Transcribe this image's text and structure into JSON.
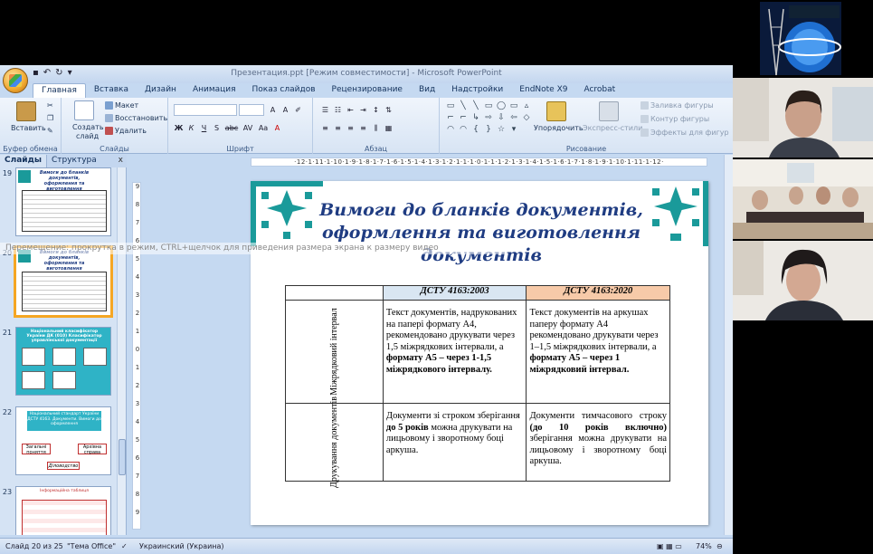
{
  "window": {
    "title": "Презентация.ppt [Режим совместимости] - Microsoft PowerPoint"
  },
  "ribbon": {
    "tabs": [
      "Главная",
      "Вставка",
      "Дизайн",
      "Анимация",
      "Показ слайдов",
      "Рецензирование",
      "Вид",
      "Надстройки",
      "EndNote X9",
      "Acrobat"
    ],
    "active_tab": "Главная",
    "clipboard": {
      "paste": "Вставить",
      "label": "Буфер обмена"
    },
    "slides_group": {
      "create": "Создать",
      "create2": "слайд",
      "layout": "Макет",
      "reset": "Восстановить",
      "delete": "Удалить",
      "label": "Слайды"
    },
    "font_group": {
      "label": "Шрифт",
      "buttons": [
        "Ж",
        "К",
        "Ч",
        "S",
        "abc",
        "AV",
        "Аа",
        "A"
      ]
    },
    "paragraph_group": {
      "label": "Абзац"
    },
    "drawing_group": {
      "arrange": "Упорядочить",
      "styles": "Экспресс-стили",
      "fill": "Заливка фигуры",
      "outline": "Контур фигуры",
      "effects": "Эффекты для фигур",
      "label": "Рисование"
    }
  },
  "panel": {
    "tab_slides": "Слайды",
    "tab_outline": "Структура",
    "close": "x",
    "thumbnails": [
      {
        "num": "19",
        "title": "Вимоги до бланків документів, оформлення та виготовлення документів"
      },
      {
        "num": "20",
        "title": "Вимоги до бланків документів, оформлення та виготовлення документів"
      },
      {
        "num": "21",
        "title": "Національний класифікатор України ДК (010) Класифікатор управлінської документації"
      },
      {
        "num": "22",
        "title": "Національний стандарт України ДСТУ 4163. Документи. Вимоги до оформлення"
      },
      {
        "num": "23",
        "title": "Інформаційна таблиця"
      }
    ],
    "thumb22_boxes": [
      "Загальні поняття",
      "Архівна справа",
      "Діловодство"
    ]
  },
  "hint": "Перемещение: прокрутка в режим, CTRL+щелчок для приведения размера экрана к размеру видео",
  "ruler": {
    "h": "·12·1·11·1·10·1·9·1·8·1·7·1·6·1·5·1·4·1·3·1·2·1·1·1·0·1·1·1·2·1·3·1·4·1·5·1·6·1·7·1·8·1·9·1·10·1·11·1·12·",
    "v": [
      "9",
      "8",
      "7",
      "6",
      "5",
      "4",
      "3",
      "2",
      "1",
      "0",
      "1",
      "2",
      "3",
      "4",
      "5",
      "6",
      "7",
      "8",
      "9"
    ]
  },
  "slide": {
    "title_line1": "Вимоги до бланків документів,",
    "title_line2": "оформлення та виготовлення",
    "title_line3": "документів",
    "table": {
      "col1": "ДСТУ 4163:2003",
      "col2": "ДСТУ 4163:2020",
      "rows": [
        {
          "head": "Міжрядковий інтервал",
          "c1_plain": "Текст документів, надрукованих на папері формату А4, рекомендовано друкувати через 1,5 міжрядкових інтервали, а ",
          "c1_bold": "формату А5 – через 1-1,5 міжрядкового інтервалу.",
          "c2_plain": "Текст документів на аркушах паперу формату А4 рекомендовано друкувати через 1–1,5 міжрядкових інтервали, а ",
          "c2_bold": "формату А5 – через 1 міжрядковий інтервал."
        },
        {
          "head": "Друкування документів",
          "c1_a": "Документи зі строком зберігання ",
          "c1_b": "до 5 років",
          "c1_c": " можна друкувати на лицьовому і зворотному боці аркуша.",
          "c2_a": "Документи тимчасового строку ",
          "c2_b": "(до 10 років включно)",
          "c2_c": " зберігання можна друкувати на лицьовому і зворотному боці аркуша."
        }
      ]
    }
  },
  "status": {
    "slide": "Слайд 20 из 25",
    "theme": "\"Тема Office\"",
    "lang": "Украинский (Украина)",
    "zoom": "74%"
  },
  "colors": {
    "title_blue": "#1f3c82",
    "ornament_teal": "#1a9a9a",
    "header_blue": "#d9e6f2",
    "header_orange": "#f7caa9"
  }
}
